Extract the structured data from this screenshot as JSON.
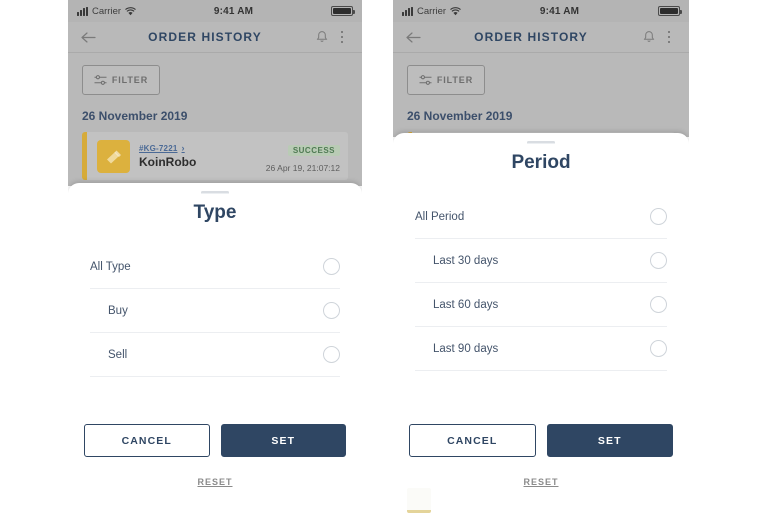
{
  "status_bar": {
    "carrier": "Carrier",
    "time": "9:41 AM"
  },
  "app": {
    "title": "ORDER HISTORY",
    "filter_label": "FILTER",
    "date_header": "26 November 2019",
    "order": {
      "id": "#KG-7221",
      "chevron": "›",
      "name": "KoinRobo",
      "status": "SUCCESS",
      "timestamp": "26 Apr 19, 21:07:12"
    }
  },
  "sheets": [
    {
      "title": "Type",
      "options": [
        {
          "label": "All Type",
          "selected": false,
          "indent": false
        },
        {
          "label": "Buy",
          "selected": false,
          "indent": true
        },
        {
          "label": "Sell",
          "selected": false,
          "indent": true
        }
      ],
      "cancel_label": "CANCEL",
      "set_label": "SET",
      "reset_label": "RESET"
    },
    {
      "title": "Period",
      "options": [
        {
          "label": "All Period",
          "selected": false,
          "indent": false
        },
        {
          "label": "Last 30 days",
          "selected": false,
          "indent": true
        },
        {
          "label": "Last 60 days",
          "selected": false,
          "indent": true
        },
        {
          "label": "Last 90 days",
          "selected": false,
          "indent": true
        }
      ],
      "cancel_label": "CANCEL",
      "set_label": "SET",
      "reset_label": "RESET"
    }
  ],
  "colors": {
    "navy": "#2f4663",
    "gold": "#dcb13e",
    "success_text": "#4f7a53",
    "success_bg": "#b9cbb5",
    "link": "#4b6a96",
    "backdrop": "#b9b9b9"
  }
}
